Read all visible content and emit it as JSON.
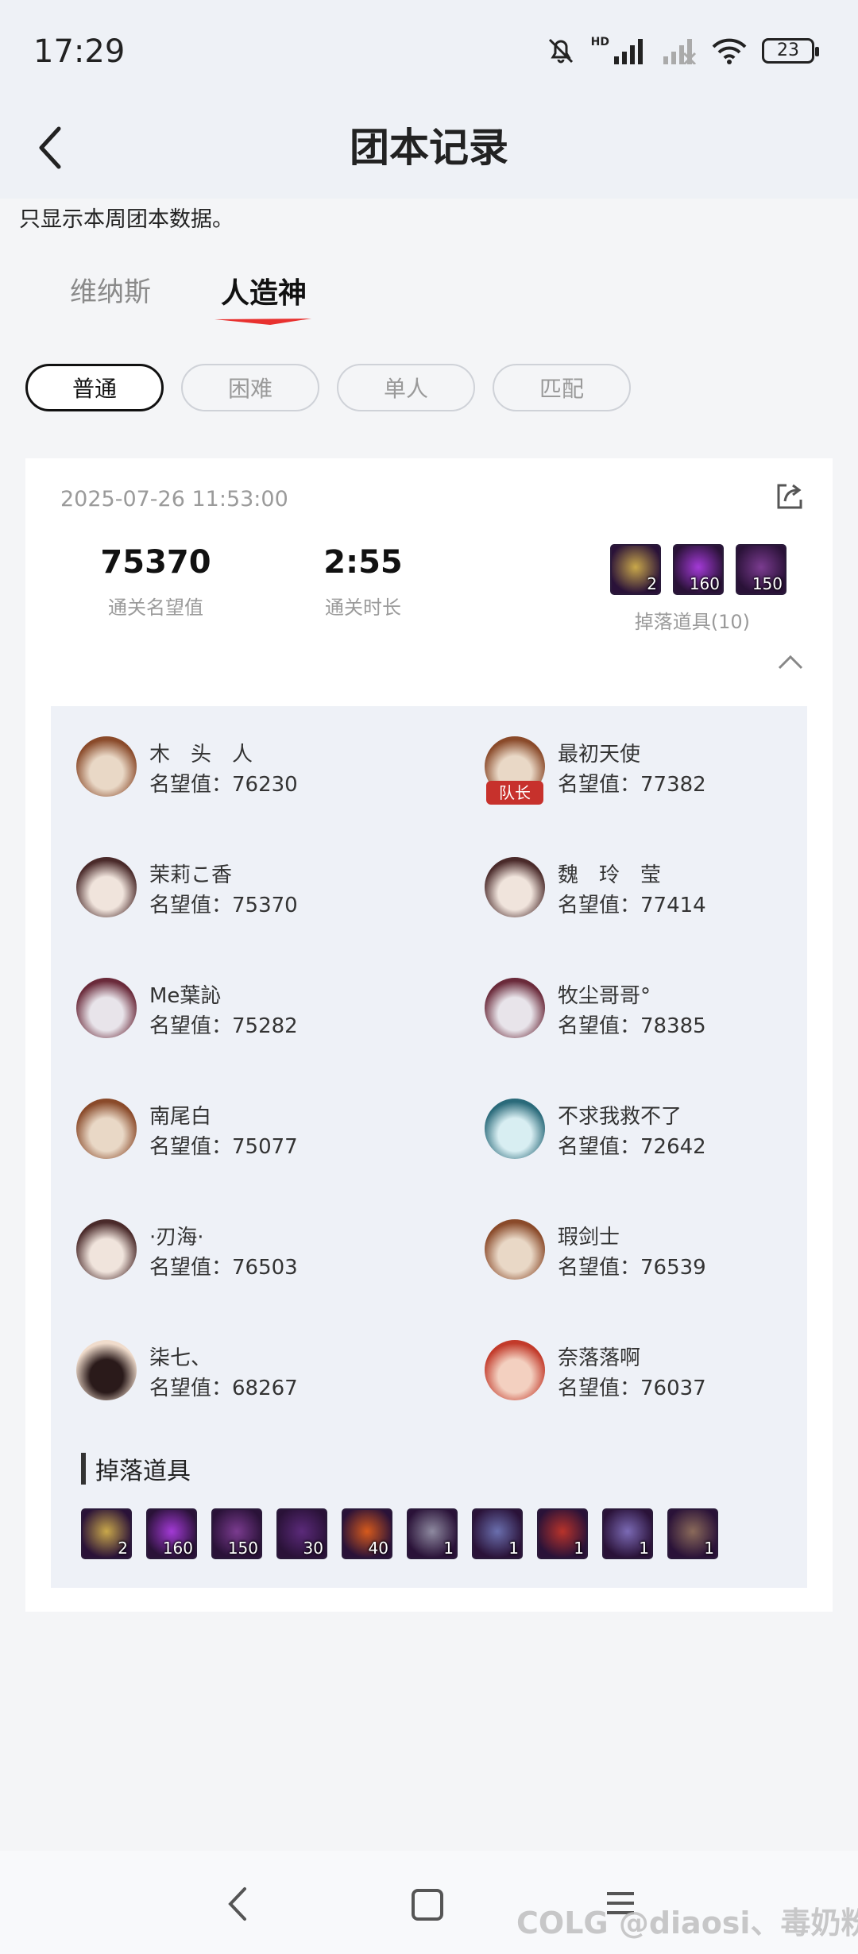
{
  "status": {
    "time": "17:29",
    "battery": "23",
    "network": "HD"
  },
  "header": {
    "title": "团本记录"
  },
  "notice": "只显示本周团本数据。",
  "tabs": [
    "维纳斯",
    "人造神"
  ],
  "filters": [
    "普通",
    "困难",
    "单人",
    "匹配"
  ],
  "record": {
    "datetime": "2025-07-26 11:53:00",
    "reputation_value": "75370",
    "reputation_label": "通关名望值",
    "duration_value": "2:55",
    "duration_label": "通关时长",
    "drops_label": "掉落道具(10)",
    "drops_section_title": "掉落道具"
  },
  "rep_prefix": "名望值：",
  "captain_badge": "队长",
  "members": [
    {
      "name": "木　头　人",
      "rep": "76230",
      "captain": false
    },
    {
      "name": "最初天使",
      "rep": "77382",
      "captain": true
    },
    {
      "name": "茉莉こ香",
      "rep": "75370",
      "captain": false
    },
    {
      "name": "魏　玲　莹",
      "rep": "77414",
      "captain": false
    },
    {
      "name": "Me葉訫",
      "rep": "75282",
      "captain": false
    },
    {
      "name": "牧尘哥哥°",
      "rep": "78385",
      "captain": false
    },
    {
      "name": "南尾白",
      "rep": "75077",
      "captain": false
    },
    {
      "name": "不求我救不了",
      "rep": "72642",
      "captain": false
    },
    {
      "name": "·刃海·",
      "rep": "76503",
      "captain": false
    },
    {
      "name": "瑕剑士",
      "rep": "76539",
      "captain": false
    },
    {
      "name": "柒七、",
      "rep": "68267",
      "captain": false
    },
    {
      "name": "奈落落啊",
      "rep": "76037",
      "captain": false
    }
  ],
  "drops": [
    {
      "icon": "gold-leaf-item-icon",
      "qty": "2",
      "color": "#c9a84a"
    },
    {
      "icon": "purple-orb-item-icon",
      "qty": "160",
      "color": "#a33ad6"
    },
    {
      "icon": "purple-rune-item-icon",
      "qty": "150",
      "color": "#7a3b8f"
    },
    {
      "icon": "dark-orb-item-icon",
      "qty": "30",
      "color": "#5b2a7a"
    },
    {
      "icon": "fire-ring-item-icon",
      "qty": "40",
      "color": "#d65a1c"
    },
    {
      "icon": "chest-item-icon",
      "qty": "1",
      "color": "#8e8aa0"
    },
    {
      "icon": "shard-item-icon",
      "qty": "1",
      "color": "#6a6fae"
    },
    {
      "icon": "red-box-item-icon",
      "qty": "1",
      "color": "#b8332a"
    },
    {
      "icon": "box-item-icon",
      "qty": "1",
      "color": "#7b6ab5"
    },
    {
      "icon": "scroll-item-icon",
      "qty": "1",
      "color": "#8a6a5a"
    }
  ],
  "watermark": "COLG @diaosi、毒奶粉"
}
